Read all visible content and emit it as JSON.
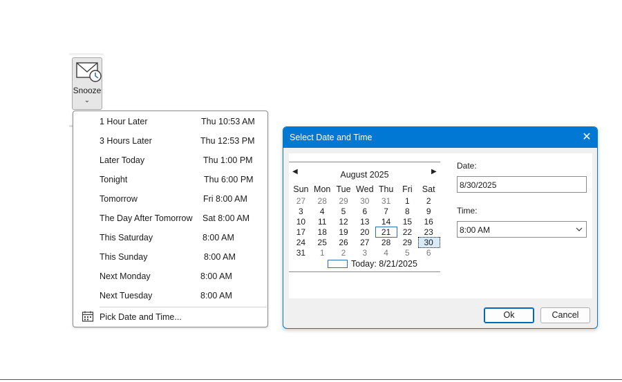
{
  "ribbon": {
    "snooze_label": "Snooze",
    "snooze_icon": "envelope-clock-icon",
    "chevron_icon": "chevron-down-icon"
  },
  "menu": {
    "items": [
      {
        "label": "1 Hour Later",
        "time": "Thu 10:53 AM"
      },
      {
        "label": "3 Hours Later",
        "time": "Thu 12:53 PM"
      },
      {
        "label": "Later Today",
        "time": "Thu 1:00 PM"
      },
      {
        "label": "Tonight",
        "time": "Thu 6:00 PM"
      },
      {
        "label": "Tomorrow",
        "time": "Fri 8:00 AM"
      },
      {
        "label": "The Day After Tomorrow",
        "time": "Sat 8:00 AM"
      },
      {
        "label": "This Saturday",
        "time": "8:00 AM"
      },
      {
        "label": "This Sunday",
        "time": "8:00 AM"
      },
      {
        "label": "Next Monday",
        "time": "8:00 AM"
      },
      {
        "label": "Next Tuesday",
        "time": "8:00 AM"
      }
    ],
    "pick_label": "Pick Date and Time...",
    "pick_icon": "calendar-icon"
  },
  "dialog": {
    "title": "Select Date and Time",
    "close_icon": "close-icon",
    "calendar": {
      "month_label": "August 2025",
      "prev_icon": "triangle-left-icon",
      "next_icon": "triangle-right-icon",
      "dow": [
        "Sun",
        "Mon",
        "Tue",
        "Wed",
        "Thu",
        "Fri",
        "Sat"
      ],
      "weeks": [
        [
          "27",
          "28",
          "29",
          "30",
          "31",
          "1",
          "2"
        ],
        [
          "3",
          "4",
          "5",
          "6",
          "7",
          "8",
          "9"
        ],
        [
          "10",
          "11",
          "12",
          "13",
          "14",
          "15",
          "16"
        ],
        [
          "17",
          "18",
          "19",
          "20",
          "21",
          "22",
          "23"
        ],
        [
          "24",
          "25",
          "26",
          "27",
          "28",
          "29",
          "30"
        ],
        [
          "31",
          "1",
          "2",
          "3",
          "4",
          "5",
          "6"
        ]
      ],
      "today_label": "Today: 8/21/2025"
    },
    "date_label": "Date:",
    "date_value": "8/30/2025",
    "time_label": "Time:",
    "time_value": "8:00 AM",
    "ok_label": "Ok",
    "cancel_label": "Cancel",
    "accent_color": "#0078d4"
  }
}
